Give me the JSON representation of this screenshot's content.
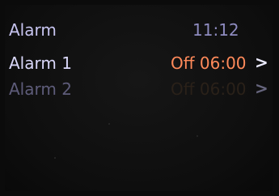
{
  "header": {
    "title": "Alarm",
    "time": "11:12"
  },
  "alarms": [
    {
      "label": "Alarm 1",
      "status": "Off 06:00",
      "chevron": ">",
      "state": "selected",
      "color": "#ff8a5a"
    },
    {
      "label": "Alarm 2",
      "status": "Off 06:00",
      "chevron": ">",
      "state": "dimmed",
      "color": "#2a2119"
    }
  ],
  "colors": {
    "background": "#0e0e0e",
    "accent": "#ff8a5a",
    "text": "#dad8fa"
  }
}
